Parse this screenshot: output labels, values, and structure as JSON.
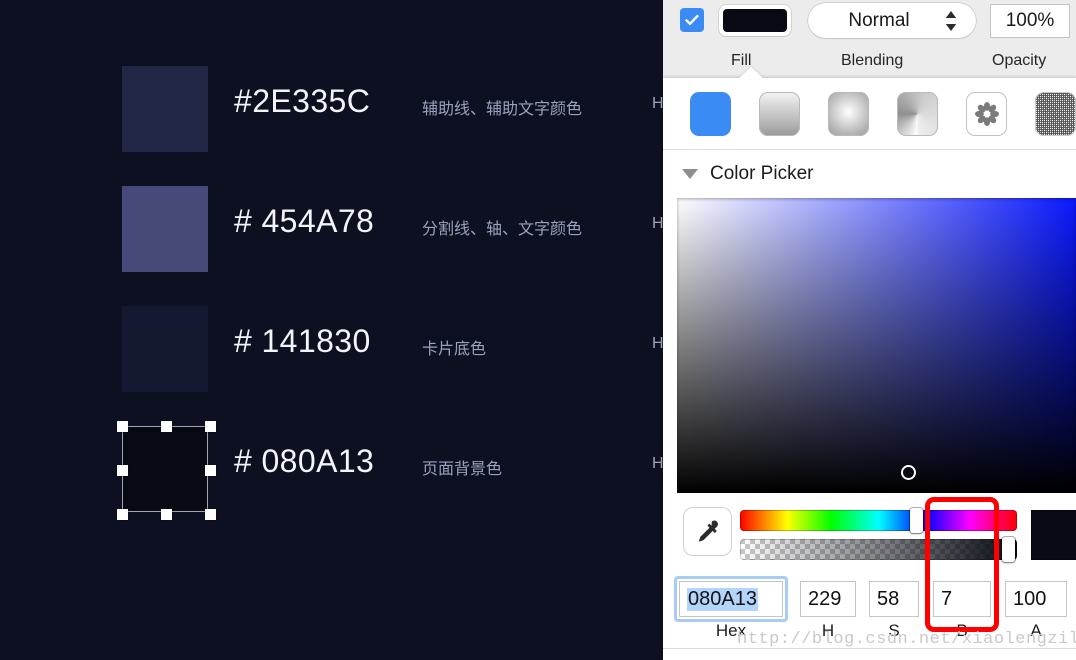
{
  "canvas": {
    "background_color": "#0d1021",
    "palette": [
      {
        "swatch_color": "#222746",
        "hex_label": "#2E335C",
        "description": "辅助线、辅助文字颜色",
        "truncated_column": "H",
        "selected": false
      },
      {
        "swatch_color": "#454A78",
        "hex_label": "# 454A78",
        "description": "分割线、轴、文字颜色",
        "truncated_column": "H",
        "selected": false
      },
      {
        "swatch_color": "#141830",
        "hex_label": "# 141830",
        "description": "卡片底色",
        "truncated_column": "H",
        "selected": false
      },
      {
        "swatch_color": "#080A13",
        "hex_label": "# 080A13",
        "description": "页面背景色",
        "truncated_column": "H",
        "selected": true
      }
    ]
  },
  "inspector": {
    "fill_enabled": true,
    "fill_swatch_color": "#080A13",
    "blending_mode": "Normal",
    "opacity": "100%",
    "labels": {
      "fill": "Fill",
      "blending": "Blending",
      "opacity": "Opacity"
    },
    "fill_types": [
      {
        "name": "solid-color",
        "selected": true
      },
      {
        "name": "linear-gradient",
        "selected": false
      },
      {
        "name": "radial-gradient",
        "selected": false
      },
      {
        "name": "angular-gradient",
        "selected": false
      },
      {
        "name": "pattern-fill",
        "selected": false
      },
      {
        "name": "noise-fill",
        "selected": false
      }
    ],
    "color_picker": {
      "section_title": "Color Picker",
      "expanded": true,
      "hue_degrees": 229,
      "saturation_percent": 58,
      "brightness_percent": 7,
      "alpha_percent": 100,
      "preview_color": "#080A13",
      "fields": [
        {
          "key": "hex",
          "value": "080A13",
          "caption": "Hex",
          "focused": true,
          "annotated": false
        },
        {
          "key": "h",
          "value": "229",
          "caption": "H",
          "focused": false,
          "annotated": false
        },
        {
          "key": "s",
          "value": "58",
          "caption": "S",
          "focused": false,
          "annotated": false
        },
        {
          "key": "b",
          "value": "7",
          "caption": "B",
          "focused": false,
          "annotated": true
        },
        {
          "key": "a",
          "value": "100",
          "caption": "A",
          "focused": false,
          "annotated": false
        }
      ],
      "annotation_color": "#FE0000"
    }
  },
  "watermark": {
    "text": "http://blog.csdn.net/xiaolengzile"
  }
}
